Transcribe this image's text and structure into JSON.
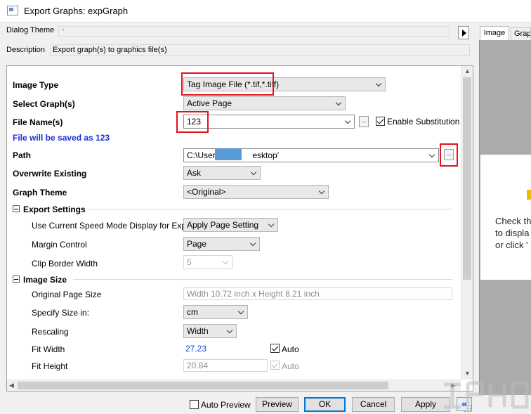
{
  "window": {
    "title": "Export Graphs: expGraph"
  },
  "top": {
    "dialog_theme_label": "Dialog Theme",
    "dialog_theme_value": "*",
    "description_label": "Description",
    "description_value": "Export graph(s) to graphics file(s)"
  },
  "preview": {
    "tabs": [
      "Image",
      "Graph"
    ],
    "text": "Check th\nto displa\nor click '"
  },
  "grid": {
    "image_type": {
      "label": "Image Type",
      "value": "Tag Image File (*.tif,*.tiff)"
    },
    "select_graphs": {
      "label": "Select Graph(s)",
      "value": "Active Page"
    },
    "file_names": {
      "label": "File Name(s)",
      "value": "123",
      "dots": "...",
      "substitution_label": "Enable Substitution",
      "substitution_checked": true
    },
    "save_note": "File will be saved as 123",
    "path": {
      "label": "Path",
      "value_prefix": "C:\\Users",
      "value_suffix": "esktop'",
      "dots": "..."
    },
    "overwrite": {
      "label": "Overwrite Existing",
      "value": "Ask"
    },
    "graph_theme": {
      "label": "Graph Theme",
      "value": "<Original>"
    },
    "export_settings": {
      "label": "Export Settings",
      "speed_mode": {
        "label": "Use Current Speed Mode Display for Export",
        "value": "Apply Page Setting"
      },
      "margin": {
        "label": "Margin Control",
        "value": "Page"
      },
      "clip_border": {
        "label": "Clip Border Width",
        "value": "5"
      }
    },
    "image_size": {
      "label": "Image Size",
      "original_page": {
        "label": "Original Page Size",
        "value": "Width 10.72 inch x Height 8.21 inch"
      },
      "specify_size": {
        "label": "Specify Size in:",
        "value": "cm"
      },
      "rescaling": {
        "label": "Rescaling",
        "value": "Width"
      },
      "fit_width": {
        "label": "Fit Width",
        "value": "27.23",
        "auto_label": "Auto",
        "auto_checked": true
      },
      "fit_height": {
        "label": "Fit Height",
        "value": "20.84",
        "auto_label": "Auto",
        "auto_checked": true
      }
    }
  },
  "buttons": {
    "auto_preview_label": "Auto Preview",
    "auto_preview_checked": false,
    "preview": "Preview",
    "ok": "OK",
    "cancel": "Cancel",
    "apply": "Apply",
    "collapse": "«"
  },
  "colors": {
    "highlight": "#e0141e",
    "note": "#1c2cd6",
    "link_value": "#1a48c8"
  }
}
